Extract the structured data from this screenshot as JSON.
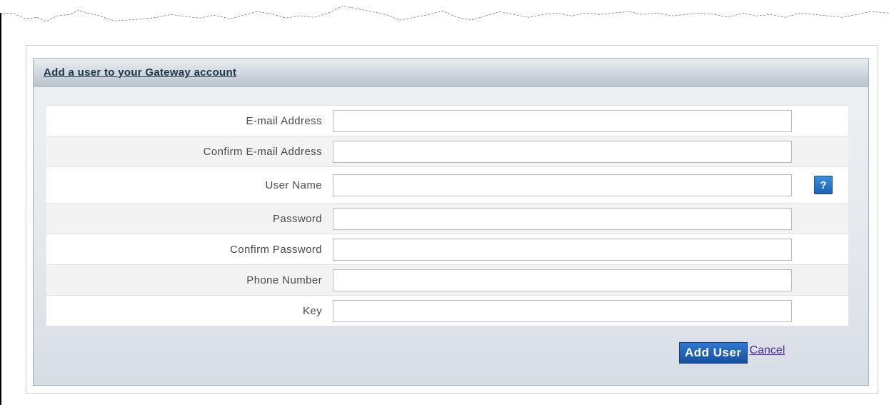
{
  "panel": {
    "title": "Add a user to your Gateway account"
  },
  "form": {
    "fields": [
      {
        "label": "E-mail Address",
        "value": "",
        "placeholder": ""
      },
      {
        "label": "Confirm E-mail Address",
        "value": "",
        "placeholder": ""
      },
      {
        "label": "User Name",
        "value": "",
        "placeholder": ""
      },
      {
        "label": "Password",
        "value": "",
        "placeholder": ""
      },
      {
        "label": "Confirm Password",
        "value": "",
        "placeholder": ""
      },
      {
        "label": "Phone Number",
        "value": "",
        "placeholder": ""
      },
      {
        "label": "Key",
        "value": "",
        "placeholder": ""
      }
    ],
    "help_icon_label": "?"
  },
  "actions": {
    "add_user_label": "Add User",
    "cancel_label": "Cancel"
  },
  "colors": {
    "accent_button": "#1c5fb0",
    "header_title": "#1f3347",
    "link": "#4b2a9a"
  },
  "icons": {
    "help": "question-mark-icon"
  }
}
